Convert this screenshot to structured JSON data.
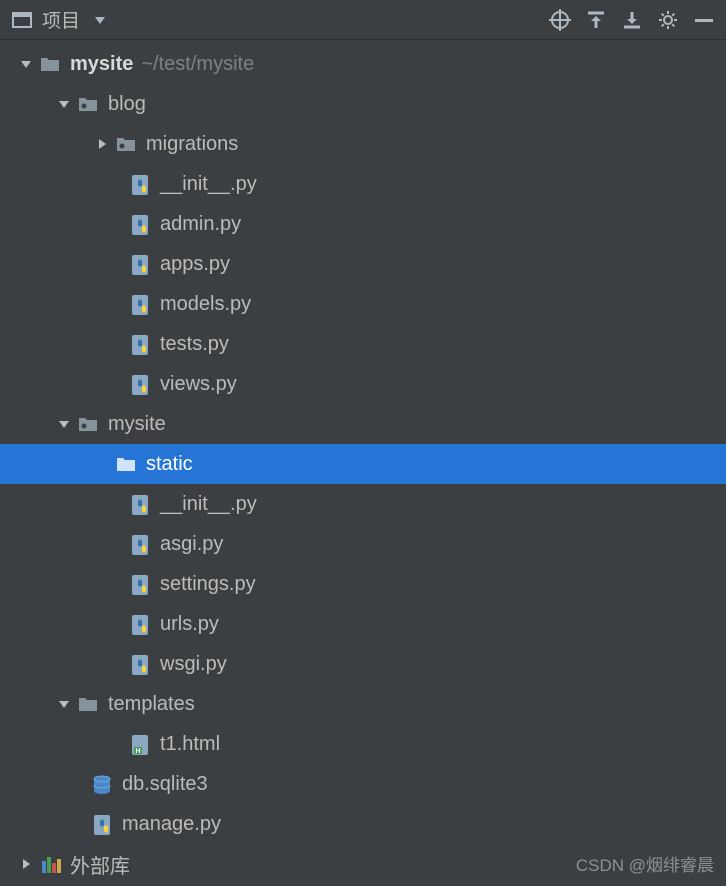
{
  "toolbar": {
    "title": "项目"
  },
  "tree": {
    "root": {
      "name": "mysite",
      "path": "~/test/mysite"
    },
    "blog": "blog",
    "migrations": "migrations",
    "init1": "__init__.py",
    "admin": "admin.py",
    "apps": "apps.py",
    "models": "models.py",
    "tests": "tests.py",
    "views": "views.py",
    "mysite2": "mysite",
    "static": "static",
    "init2": "__init__.py",
    "asgi": "asgi.py",
    "settings": "settings.py",
    "urls": "urls.py",
    "wsgi": "wsgi.py",
    "templates": "templates",
    "t1": "t1.html",
    "db": "db.sqlite3",
    "manage": "manage.py",
    "external": "外部库"
  },
  "watermark": "CSDN @烟绯睿晨"
}
